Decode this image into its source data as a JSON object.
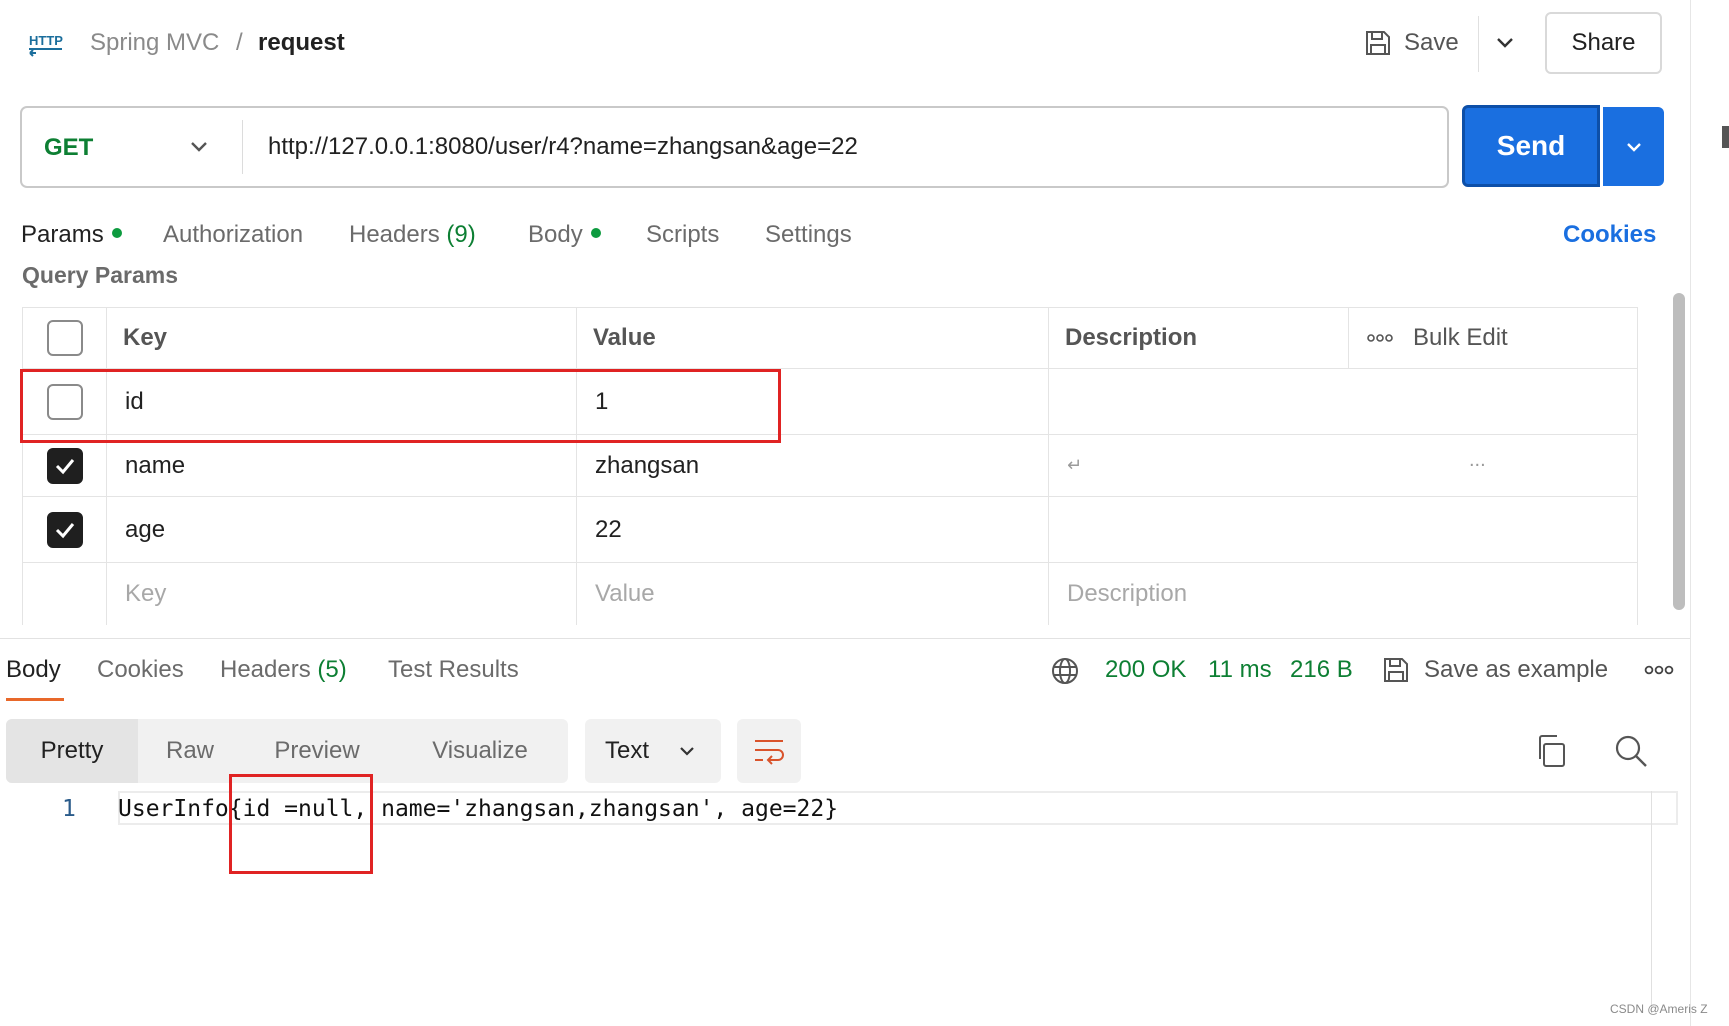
{
  "header": {
    "http_icon_label": "HTTP",
    "collection": "Spring MVC",
    "separator": "/",
    "request_name": "request",
    "save_label": "Save",
    "share_label": "Share"
  },
  "request": {
    "method": "GET",
    "url": "http://127.0.0.1:8080/user/r4?name=zhangsan&age=22",
    "send_label": "Send"
  },
  "request_tabs": {
    "params": "Params",
    "authorization": "Authorization",
    "headers": "Headers",
    "headers_count": "(9)",
    "body": "Body",
    "scripts": "Scripts",
    "settings": "Settings",
    "cookies": "Cookies"
  },
  "query_params": {
    "title": "Query Params",
    "headers": {
      "key": "Key",
      "value": "Value",
      "description": "Description",
      "bulk_edit": "Bulk Edit"
    },
    "rows": [
      {
        "checked": false,
        "key": "id",
        "value": "1",
        "description": ""
      },
      {
        "checked": true,
        "key": "name",
        "value": "zhangsan",
        "description": "",
        "return_glyph": "↵",
        "ellipsis": "..."
      },
      {
        "checked": true,
        "key": "age",
        "value": "22",
        "description": ""
      }
    ],
    "placeholder": {
      "key": "Key",
      "value": "Value",
      "description": "Description"
    }
  },
  "response": {
    "tabs": {
      "body": "Body",
      "cookies": "Cookies",
      "headers": "Headers",
      "headers_count": "(5)",
      "test_results": "Test Results"
    },
    "status": "200 OK",
    "time": "11 ms",
    "size": "216 B",
    "save_example": "Save as example",
    "views": {
      "pretty": "Pretty",
      "raw": "Raw",
      "preview": "Preview",
      "visualize": "Visualize"
    },
    "format": "Text",
    "line_number": "1",
    "body_text": "UserInfo{id =null, name='zhangsan,zhangsan', age=22}"
  },
  "colors": {
    "accent_blue": "#1a6fe0",
    "method_green": "#0d7f33",
    "status_green": "#0d7f33",
    "highlight_red": "#e02323",
    "tab_underline": "#e8682a"
  },
  "watermark": "CSDN @Ameris Z"
}
